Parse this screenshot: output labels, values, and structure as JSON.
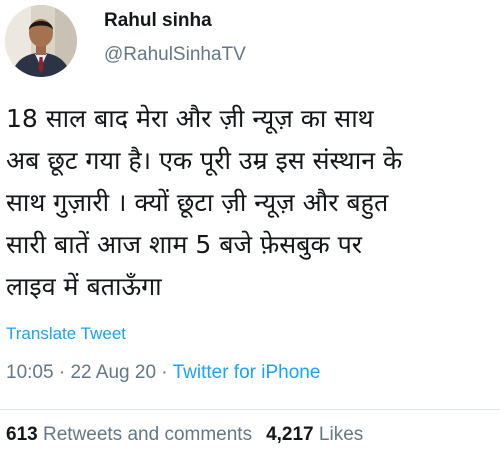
{
  "user": {
    "display_name": "Rahul sinha",
    "handle": "@RahulSinhaTV"
  },
  "tweet": {
    "lines": [
      "18 साल बाद मेरा और ज़ी न्यूज़ का साथ",
      "अब छूट गया है। एक पूरी उम्र इस संस्थान के",
      "साथ गुज़ारी । क्यों छूटा ज़ी न्यूज़ और बहुत",
      "सारी बातें आज शाम 5 बजे फ़ेसबुक पर",
      "लाइव में बताऊँगा"
    ],
    "translate_label": "Translate Tweet"
  },
  "meta": {
    "time": "10:05",
    "separator": " · ",
    "date": "22 Aug 20",
    "source": "Twitter for iPhone"
  },
  "stats": {
    "retweets_count": "613",
    "retweets_label": "Retweets and comments",
    "likes_count": "4,217",
    "likes_label": "Likes"
  },
  "colors": {
    "link_blue": "#1da1f2",
    "secondary_text": "#657786",
    "primary_text": "#14171a"
  },
  "icons": {
    "avatar": "profile-photo-avatar"
  }
}
